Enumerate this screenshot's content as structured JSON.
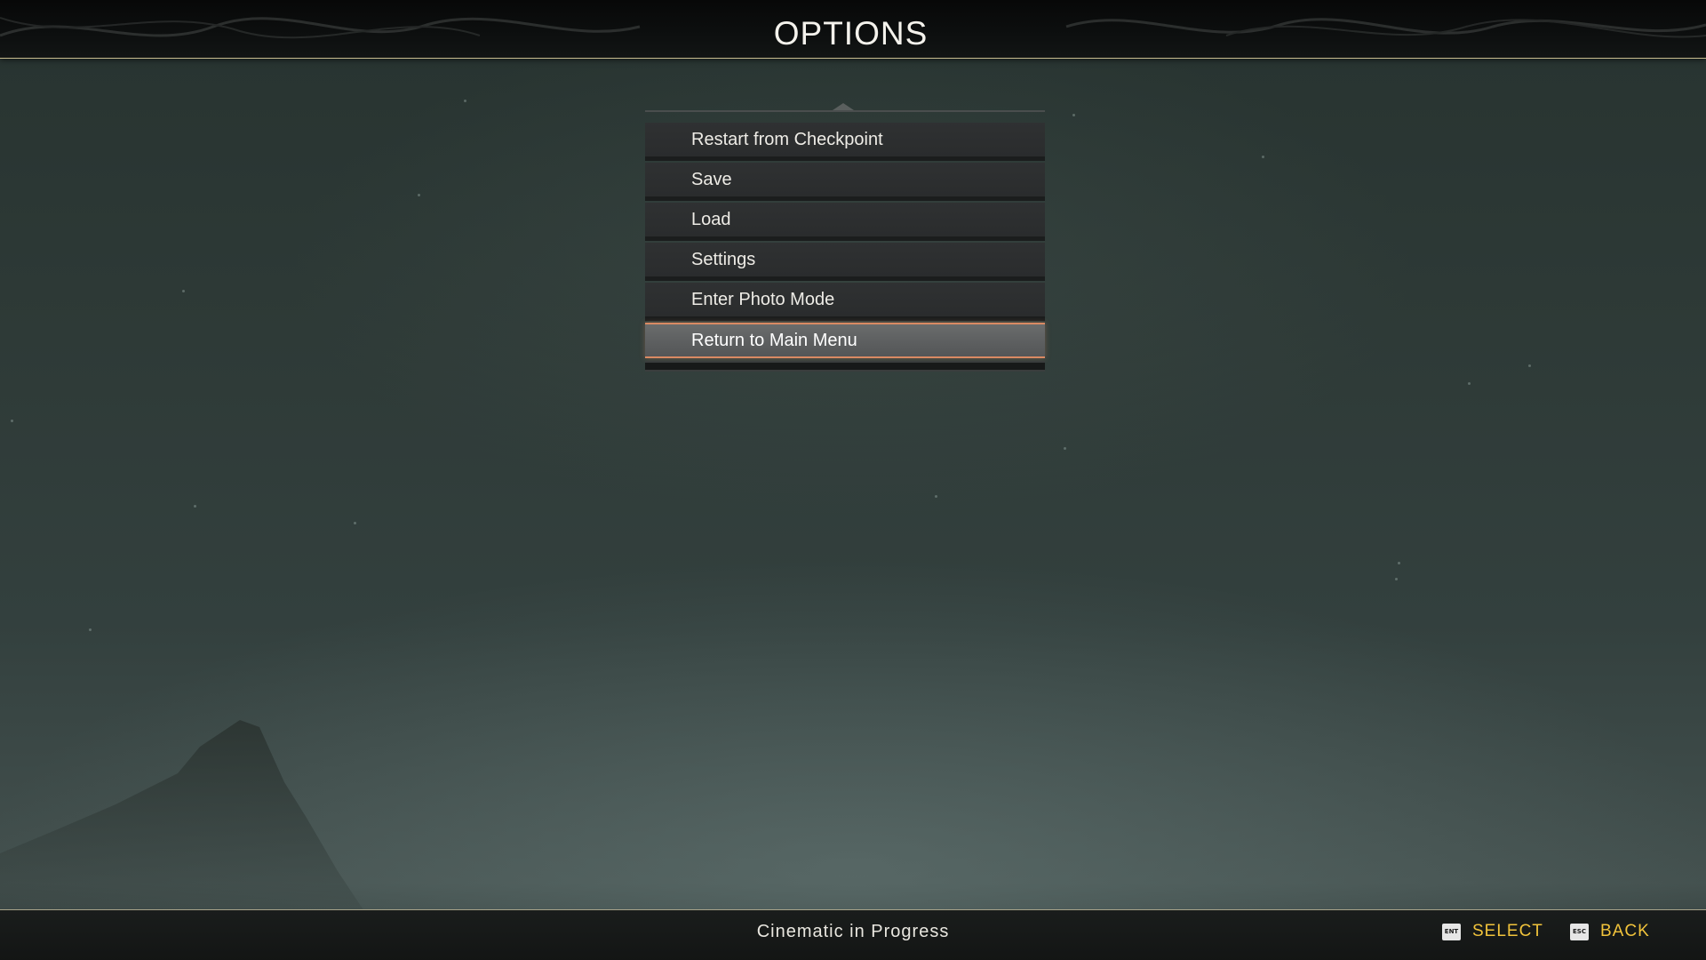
{
  "header": {
    "title": "OPTIONS"
  },
  "menu": {
    "items": [
      {
        "label": "Restart from Checkpoint"
      },
      {
        "label": "Save"
      },
      {
        "label": "Load"
      },
      {
        "label": "Settings"
      },
      {
        "label": "Enter Photo Mode"
      },
      {
        "label": "Return to Main Menu"
      }
    ],
    "selected": "Return to Main Menu"
  },
  "footer": {
    "status": "Cinematic in Progress",
    "prompts": [
      {
        "key": "ENT",
        "label": "SELECT",
        "icon": "enter-key-icon"
      },
      {
        "key": "ESC",
        "label": "BACK",
        "icon": "escape-key-icon"
      }
    ]
  },
  "colors": {
    "accent": "#d98a63",
    "prompt": "#f1c33b",
    "header_rule": "#c8bd8f"
  }
}
